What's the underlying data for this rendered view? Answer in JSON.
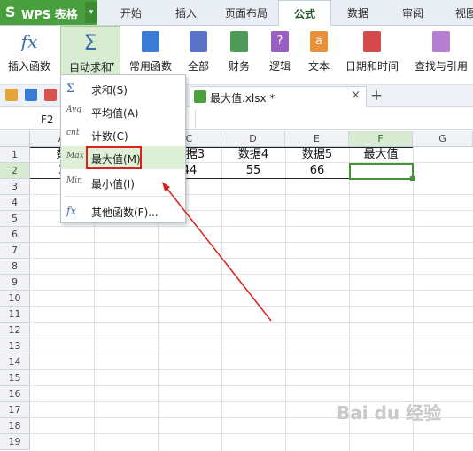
{
  "app": {
    "name": "WPS 表格",
    "logo": "S"
  },
  "tabs": [
    "开始",
    "插入",
    "页面布局",
    "公式",
    "数据",
    "审阅",
    "视图"
  ],
  "ribbon": {
    "buttons": [
      {
        "label": "插入函数",
        "icon": "fx-icon"
      },
      {
        "label": "自动求和",
        "icon": "sigma-icon"
      },
      {
        "label": "常用函数",
        "icon": "star-book-icon",
        "color": "#3a7bd5"
      },
      {
        "label": "全部",
        "icon": "book-icon",
        "color": "#5a73c8"
      },
      {
        "label": "财务",
        "icon": "book-icon",
        "color": "#4e9a57"
      },
      {
        "label": "逻辑",
        "icon": "question-book-icon",
        "color": "#9a5fc2"
      },
      {
        "label": "文本",
        "icon": "text-book-icon",
        "color": "#e8903a"
      },
      {
        "label": "日期和时间",
        "icon": "clock-book-icon",
        "color": "#d24a4a"
      },
      {
        "label": "查找与引用",
        "icon": "search-book-icon",
        "color": "#b77fd0"
      }
    ]
  },
  "document": {
    "tab_name": "最大值.xlsx *",
    "close": "×",
    "new_tab": "+"
  },
  "formula_bar": {
    "name_box": "F2"
  },
  "columns": [
    "A",
    "B",
    "C",
    "D",
    "E",
    "F",
    "G"
  ],
  "rows": [
    "1",
    "2",
    "3",
    "4",
    "5",
    "6",
    "7",
    "8",
    "9",
    "10",
    "11",
    "12",
    "13",
    "14",
    "15",
    "16",
    "17",
    "18",
    "19"
  ],
  "cells": {
    "A1": "数",
    "C1": "数据3",
    "D1": "数据4",
    "E1": "数据5",
    "F1": "最大值",
    "A2": "3",
    "C2": "44",
    "D2": "55",
    "E2": "66"
  },
  "menu": {
    "items": [
      {
        "icon_text": "Σ",
        "label": "求和(S)"
      },
      {
        "icon_text": "Avg",
        "label": "平均值(A)"
      },
      {
        "icon_text": "cnt",
        "label": "计数(C)"
      },
      {
        "icon_text": "Max",
        "label": "最大值(M)"
      },
      {
        "icon_text": "Min",
        "label": "最小值(I)"
      },
      {
        "icon_text": "fx",
        "label": "其他函数(F)..."
      }
    ]
  },
  "colors": {
    "accent_green": "#4a9f3f",
    "highlight_red": "#e02020"
  }
}
